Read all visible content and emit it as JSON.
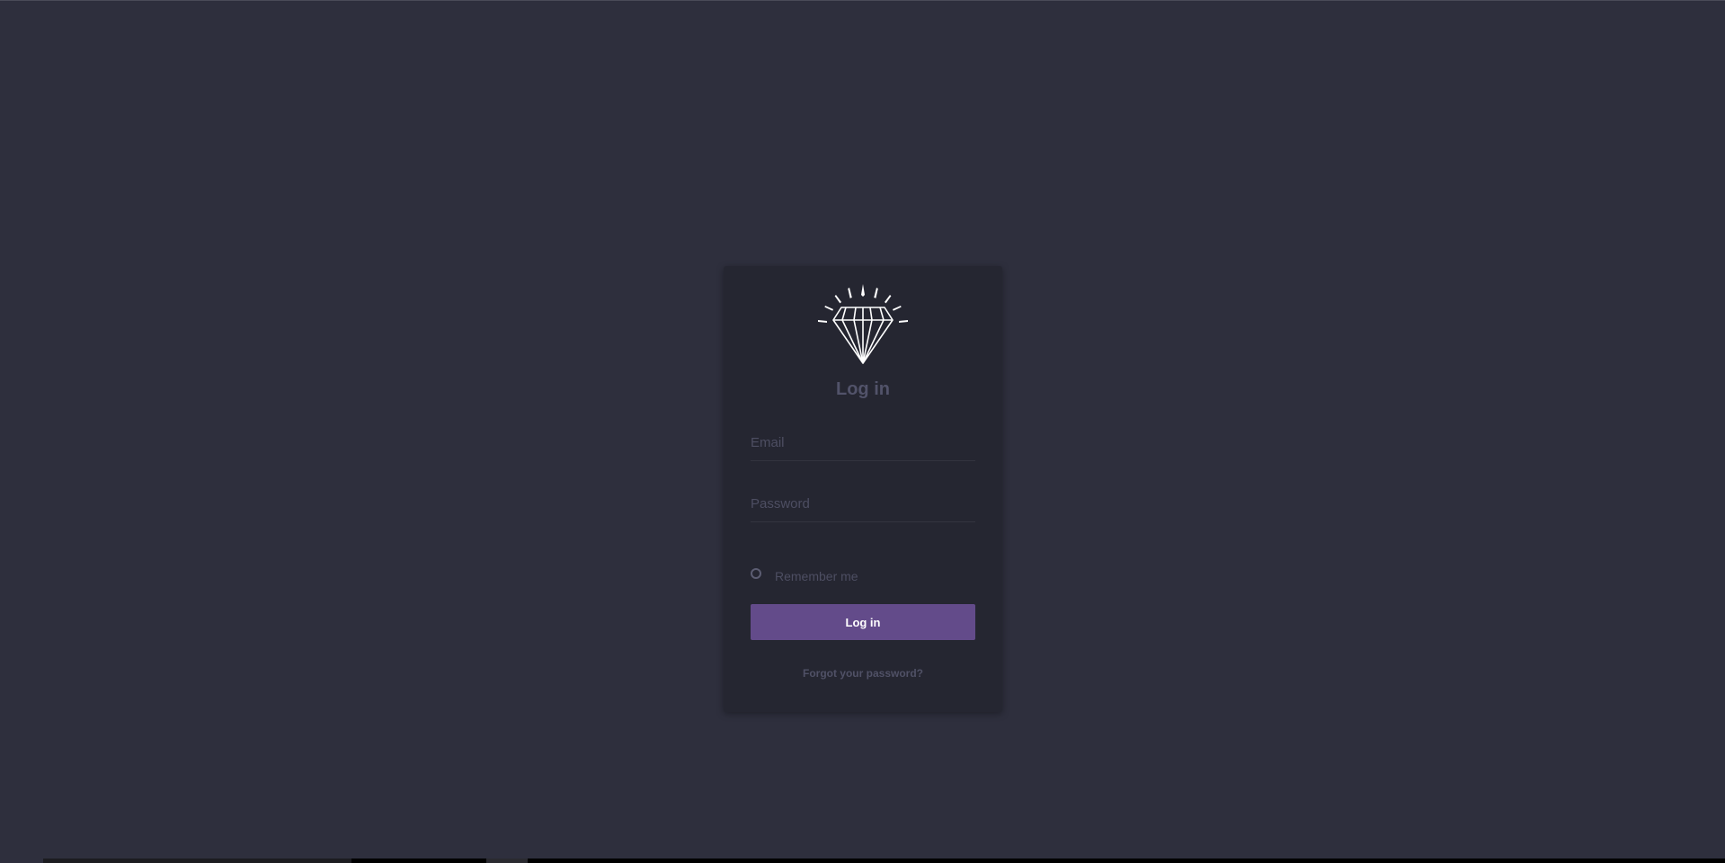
{
  "login": {
    "title": "Log in",
    "email_placeholder": "Email",
    "password_placeholder": "Password",
    "remember_label": "Remember me",
    "submit_label": "Log in",
    "forgot_label": "Forgot your password?"
  },
  "icons": {
    "logo": "diamond-icon",
    "remember": "radio-icon"
  },
  "colors": {
    "background": "#2e2f3d",
    "card": "#252631",
    "accent": "#634b8a"
  }
}
